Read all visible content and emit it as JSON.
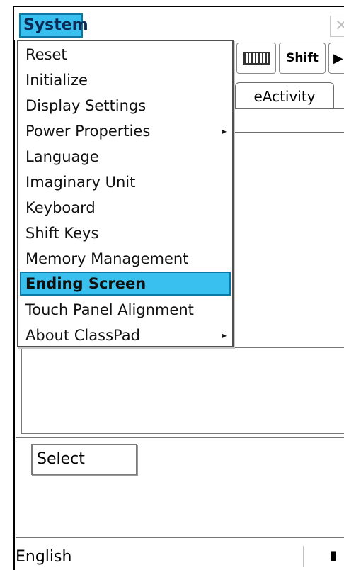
{
  "titlebar": {
    "title": "System",
    "close_icon": "close-icon"
  },
  "toolbar": {
    "keyboard_icon": "keyboard-icon",
    "shift_label": "Shift",
    "play_icon": "play-icon"
  },
  "tab": {
    "label": "eActivity"
  },
  "menu": {
    "items": [
      {
        "label": "Reset",
        "has_submenu": false
      },
      {
        "label": "Initialize",
        "has_submenu": false
      },
      {
        "label": "Display Settings",
        "has_submenu": false
      },
      {
        "label": "Power Properties",
        "has_submenu": true
      },
      {
        "label": "Language",
        "has_submenu": false
      },
      {
        "label": "Imaginary Unit",
        "has_submenu": false
      },
      {
        "label": "Keyboard",
        "has_submenu": false
      },
      {
        "label": "Shift Keys",
        "has_submenu": false
      },
      {
        "label": "Memory Management",
        "has_submenu": false
      },
      {
        "label": "Ending Screen",
        "has_submenu": false,
        "selected": true
      },
      {
        "label": "Touch Panel Alignment",
        "has_submenu": false
      },
      {
        "label": "About ClassPad",
        "has_submenu": true
      }
    ],
    "submenu_arrow": "▸"
  },
  "select_button": {
    "label": "Select"
  },
  "statusbar": {
    "language": "English",
    "battery_icon": "battery-icon"
  },
  "colors": {
    "selection": "#39c0ef",
    "selection_border": "#0b78a6"
  }
}
